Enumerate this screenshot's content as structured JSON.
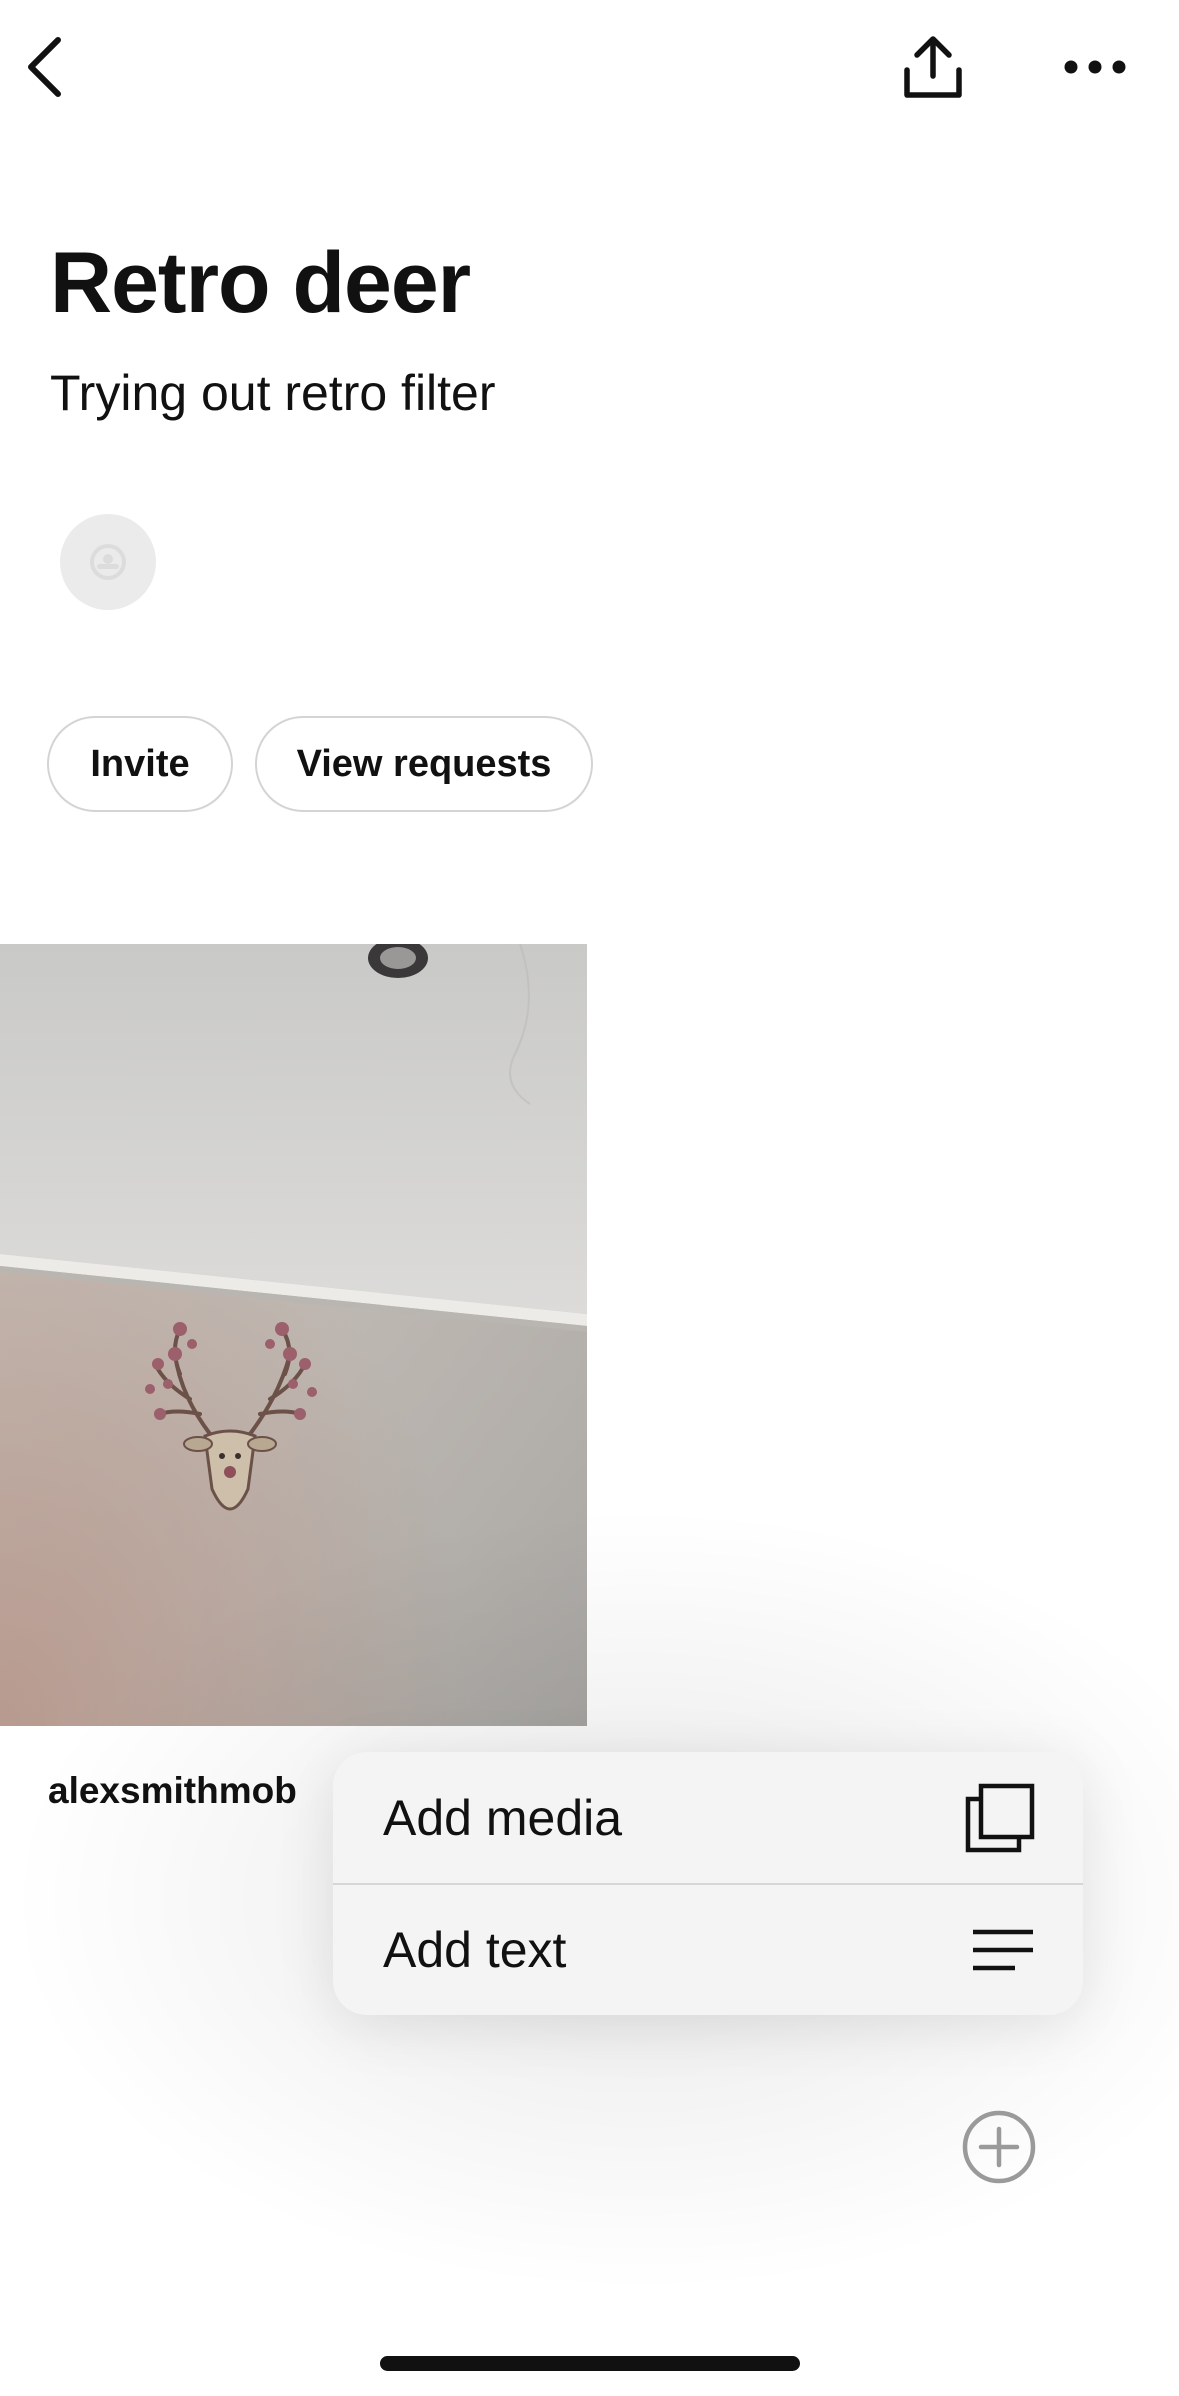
{
  "header": {
    "back_icon": "chevron-left-icon",
    "share_icon": "share-upload-icon",
    "more_icon": "more-horizontal-icon"
  },
  "board": {
    "title": "Retro deer",
    "description": "Trying out retro filter",
    "collaborator_icon": "user-placeholder-icon"
  },
  "actions": {
    "invite_label": "Invite",
    "view_requests_label": "View requests"
  },
  "post": {
    "author": "alexsmithmob"
  },
  "add_menu": {
    "items": [
      {
        "label": "Add media",
        "icon": "media-stack-icon"
      },
      {
        "label": "Add text",
        "icon": "text-lines-icon"
      }
    ]
  },
  "fab": {
    "icon": "plus-circle-icon"
  }
}
